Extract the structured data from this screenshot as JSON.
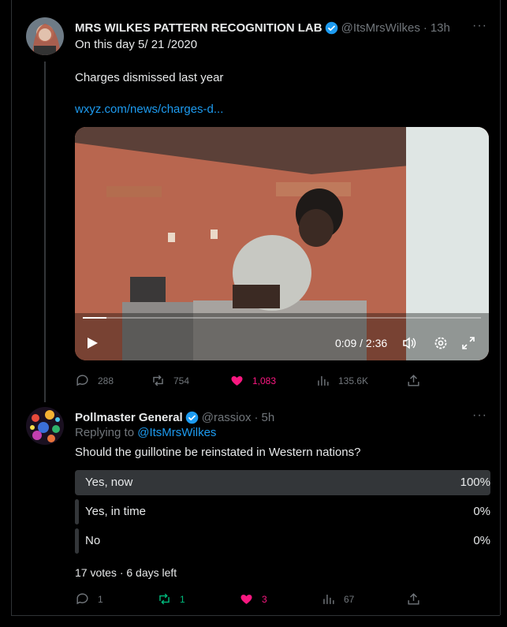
{
  "tweet1": {
    "name": "MRS WILKES PATTERN RECOGNITION LAB",
    "handle": "@ItsMrsWilkes",
    "sep": "·",
    "time": "13h",
    "line1": "On this day  5/ 21 /2020",
    "line2": "Charges dismissed last year",
    "link": "wxyz.com/news/charges-d...",
    "video": {
      "time": "0:09 / 2:36",
      "progress": 0.06
    },
    "stats": {
      "replies": "288",
      "retweets": "754",
      "likes": "1,083",
      "views": "135.6K"
    }
  },
  "tweet2": {
    "name": "Pollmaster General",
    "handle": "@rassiox",
    "sep": "·",
    "time": "5h",
    "replying_prefix": "Replying to ",
    "replying_to": "@ItsMrsWilkes",
    "question": "Should the guillotine be reinstated in Western nations?",
    "poll": [
      {
        "label": "Yes, now",
        "pct": "100%",
        "fraction": 1.0
      },
      {
        "label": "Yes, in time",
        "pct": "0%",
        "fraction": 0.0
      },
      {
        "label": "No",
        "pct": "0%",
        "fraction": 0.0
      }
    ],
    "poll_meta": "17 votes · 6 days left",
    "stats": {
      "replies": "1",
      "retweets": "1",
      "likes": "3",
      "views": "67"
    }
  },
  "colors": {
    "accent": "#1d9bf0",
    "like": "#f91880",
    "retweet": "#00ba7c",
    "muted": "#71767b"
  },
  "more_glyph": "···"
}
